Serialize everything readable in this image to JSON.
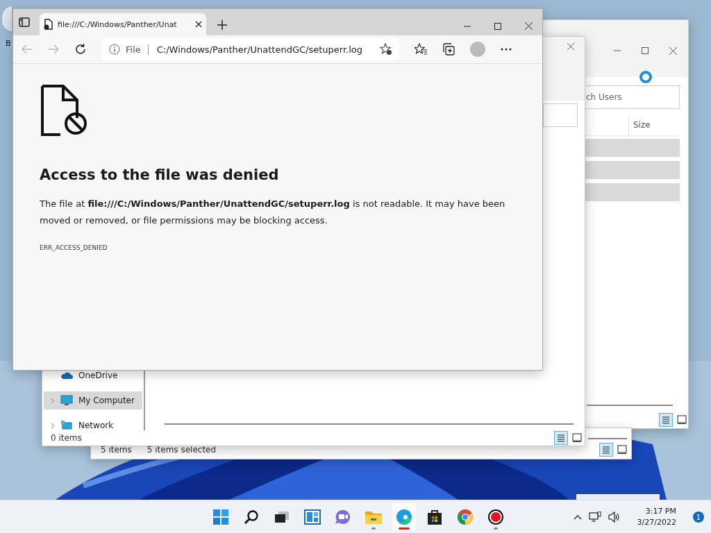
{
  "desktop": {
    "icon_label": "B"
  },
  "users_window": {
    "search_placeholder": "ch Users",
    "column": "Size"
  },
  "explorer_window": {
    "sidebar": [
      {
        "label": "OneDrive",
        "kind": "cloud",
        "selected": false,
        "expandable": false
      },
      {
        "label": "My Computer",
        "kind": "computer",
        "selected": true,
        "expandable": true
      },
      {
        "label": "Network",
        "kind": "network",
        "selected": false,
        "expandable": true
      }
    ],
    "status": "0 items"
  },
  "back_window": {
    "status": [
      "5 items",
      "5 items selected"
    ]
  },
  "browser": {
    "tab_title": "file:///C:/Windows/Panther/Unat",
    "site_label": "File",
    "address": "C:/Windows/Panther/UnattendGC/setuperr.log",
    "error_title": "Access to the file was denied",
    "error_message": "The file at **file:///C:/Windows/Panther/UnattendGC/setuperr.log** is not readable. It may have been moved or removed, or file permissions may be blocking access.",
    "error_code": "ERR_ACCESS_DENIED"
  },
  "taskbar": {
    "apps": [
      {
        "kind": "start",
        "running": false,
        "active": false
      },
      {
        "kind": "search",
        "running": false,
        "active": false
      },
      {
        "kind": "taskview",
        "running": false,
        "active": false
      },
      {
        "kind": "widgets",
        "running": false,
        "active": false
      },
      {
        "kind": "chat",
        "running": false,
        "active": false
      },
      {
        "kind": "explorer",
        "running": true,
        "active": false
      },
      {
        "kind": "edge",
        "running": true,
        "active": true
      },
      {
        "kind": "store",
        "running": false,
        "active": false
      },
      {
        "kind": "chrome",
        "running": false,
        "active": false
      },
      {
        "kind": "recorder",
        "running": true,
        "active": false
      }
    ],
    "time": "3:17 PM",
    "date": "3/27/2022",
    "notifications": "1"
  }
}
